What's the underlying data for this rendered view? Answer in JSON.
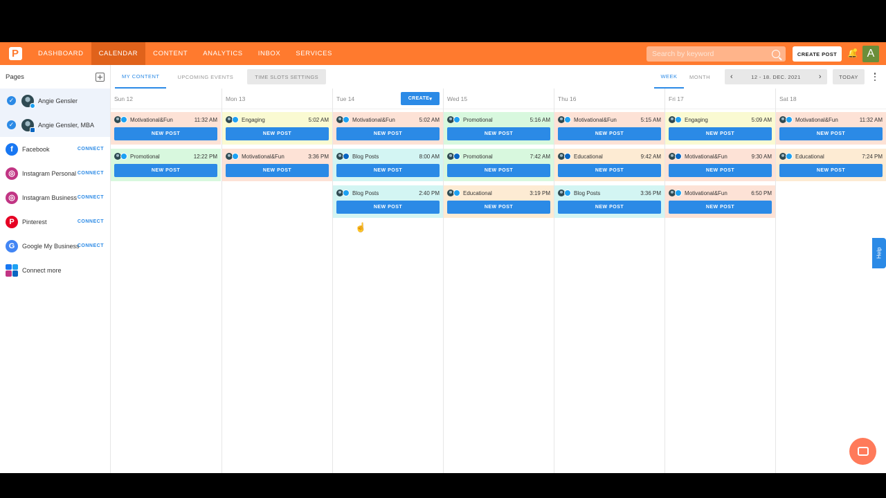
{
  "nav": {
    "items": [
      "DASHBOARD",
      "CALENDAR",
      "CONTENT",
      "ANALYTICS",
      "INBOX",
      "SERVICES"
    ],
    "active": "CALENDAR",
    "search_placeholder": "Search by keyword",
    "create_post_label": "CREATE POST",
    "avatar_letter": "A"
  },
  "sidebar": {
    "title": "Pages",
    "accounts": [
      {
        "name": "Angie Gensler",
        "badge": "twitter"
      },
      {
        "name": "Angie Gensler, MBA",
        "badge": "linkedin"
      }
    ],
    "networks": [
      {
        "name": "Facebook",
        "action": "CONNECT",
        "color": "#1877f2",
        "glyph": "f"
      },
      {
        "name": "Instagram Personal",
        "action": "CONNECT",
        "color": "#c13584",
        "glyph": "◎"
      },
      {
        "name": "Instagram Business",
        "action": "CONNECT",
        "color": "#c13584",
        "glyph": "◎"
      },
      {
        "name": "Pinterest",
        "action": "CONNECT",
        "color": "#e60023",
        "glyph": "P"
      },
      {
        "name": "Google My Business",
        "action": "CONNECT",
        "color": "#4285f4",
        "glyph": "G"
      }
    ],
    "connect_more": "Connect more"
  },
  "toolbar": {
    "tabs": [
      "MY CONTENT",
      "UPCOMING EVENTS"
    ],
    "slots_label": "TIME SLOTS SETTINGS",
    "week_label": "WEEK",
    "month_label": "MONTH",
    "date_range": "12 - 18. DEC. 2021",
    "today_label": "TODAY"
  },
  "calendar": {
    "create_label": "CREATE",
    "new_post_label": "NEW POST",
    "colors": {
      "Motivational&Fun": "#fde2d6",
      "Engaging": "#fafad2",
      "Promotional": "#d8f8de",
      "Blog Posts": "#d3f5f3",
      "Educational": "#fdebd3"
    },
    "days": [
      {
        "label": "Sun 12",
        "slots": [
          {
            "category": "Motivational&Fun",
            "time": "11:32 AM",
            "net": "tw"
          },
          {
            "category": "Promotional",
            "time": "12:22 PM",
            "net": "tw"
          }
        ]
      },
      {
        "label": "Mon 13",
        "slots": [
          {
            "category": "Engaging",
            "time": "5:02 AM",
            "net": "tw"
          },
          {
            "category": "Motivational&Fun",
            "time": "3:36 PM",
            "net": "tw"
          }
        ]
      },
      {
        "label": "Tue 14",
        "create": true,
        "slots": [
          {
            "category": "Motivational&Fun",
            "time": "5:02 AM",
            "net": "tw"
          },
          {
            "category": "Blog Posts",
            "time": "8:00 AM",
            "net": "li"
          },
          {
            "category": "Blog Posts",
            "time": "2:40 PM",
            "net": "tw"
          }
        ]
      },
      {
        "label": "Wed 15",
        "slots": [
          {
            "category": "Promotional",
            "time": "5:16 AM",
            "net": "tw"
          },
          {
            "category": "Promotional",
            "time": "7:42 AM",
            "net": "li"
          },
          {
            "category": "Educational",
            "time": "3:19 PM",
            "net": "tw"
          }
        ]
      },
      {
        "label": "Thu 16",
        "slots": [
          {
            "category": "Motivational&Fun",
            "time": "5:15 AM",
            "net": "tw"
          },
          {
            "category": "Educational",
            "time": "9:42 AM",
            "net": "li"
          },
          {
            "category": "Blog Posts",
            "time": "3:36 PM",
            "net": "tw"
          }
        ]
      },
      {
        "label": "Fri 17",
        "slots": [
          {
            "category": "Engaging",
            "time": "5:09 AM",
            "net": "tw"
          },
          {
            "category": "Motivational&Fun",
            "time": "9:30 AM",
            "net": "li"
          },
          {
            "category": "Motivational&Fun",
            "time": "6:50 PM",
            "net": "tw"
          }
        ]
      },
      {
        "label": "Sat 18",
        "slots": [
          {
            "category": "Motivational&Fun",
            "time": "11:32 AM",
            "net": "tw"
          },
          {
            "category": "Educational",
            "time": "7:24 PM",
            "net": "tw"
          }
        ]
      }
    ]
  },
  "help_label": "Help"
}
